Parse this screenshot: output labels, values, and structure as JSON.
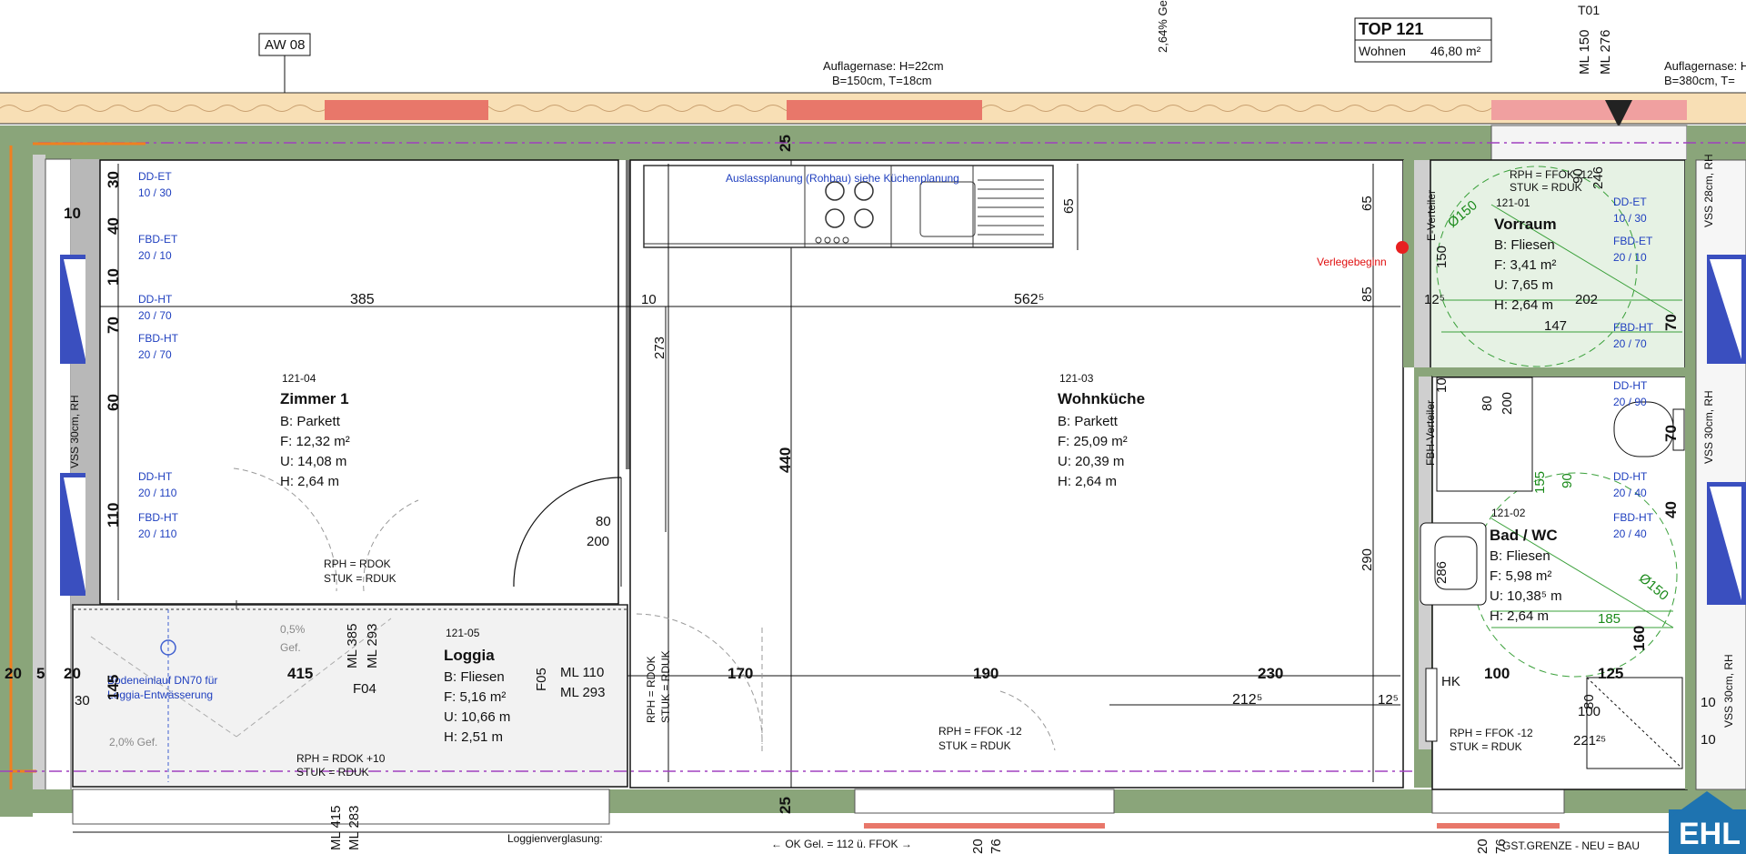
{
  "header": {
    "tag": "AW 08",
    "slope": "2,64% Ge",
    "top_title": "TOP 121",
    "top_type": "Wohnen",
    "top_area": "46,80 m²",
    "t01": "T01",
    "ml_top1": "ML 150",
    "ml_top2": "ML 276",
    "auflager_left_1": "Auflagernase: H=22cm",
    "auflager_left_2": "B=150cm, T=18cm",
    "auflager_right_1": "Auflagernase: H",
    "auflager_right_2": "B=380cm, T="
  },
  "rooms": {
    "zimmer": {
      "id": "121-04",
      "name": "Zimmer 1",
      "b": "B: Parkett",
      "f": "F: 12,32 m²",
      "u": "U: 14,08 m",
      "h": "H: 2,64 m"
    },
    "wohnkueche": {
      "id": "121-03",
      "name": "Wohnküche",
      "b": "B: Parkett",
      "f": "F: 25,09 m²",
      "u": "U: 20,39 m",
      "h": "H: 2,64 m"
    },
    "loggia": {
      "id": "121-05",
      "name": "Loggia",
      "b": "B: Fliesen",
      "f": "F: 5,16 m²",
      "u": "U: 10,66 m",
      "h": "H: 2,51 m"
    },
    "vorraum": {
      "id": "121-01",
      "name": "Vorraum",
      "b": "B: Fliesen",
      "f": "F: 3,41 m²",
      "u": "U: 7,65 m",
      "h": "H: 2,64 m"
    },
    "bad": {
      "id": "121-02",
      "name": "Bad / WC",
      "b": "B: Fliesen",
      "f": "F: 5,98 m²",
      "u": "U: 10,38⁵ m",
      "h": "H: 2,64 m"
    }
  },
  "windows_left": {
    "dd_et": "DD-ET",
    "dd_et_v": "10 / 30",
    "fbd_et": "FBD-ET",
    "fbd_et_v": "20 / 10",
    "dd_ht1": "DD-HT",
    "dd_ht1_v": "20 / 70",
    "fbd_ht1": "FBD-HT",
    "fbd_ht1_v": "20 / 70",
    "dd_ht2": "DD-HT",
    "dd_ht2_v": "20 / 110",
    "fbd_ht2": "FBD-HT",
    "fbd_ht2_v": "20 / 110",
    "vss": "VSS 30cm, RH"
  },
  "windows_right": {
    "dd_et": "DD-ET",
    "dd_et_v": "10 / 30",
    "fbd_et": "FBD-ET",
    "fbd_et_v": "20 / 10",
    "fbd_ht": "FBD-HT",
    "fbd_ht_v": "20 / 70",
    "dd_ht1": "DD-HT",
    "dd_ht1_v": "20 / 90",
    "dd_ht2": "DD-HT",
    "dd_ht2_v": "20 / 40",
    "fbd_ht2": "FBD-HT",
    "fbd_ht2_v": "20 / 40",
    "vss1": "VSS 28cm, RH",
    "vss2": "VSS 30cm, RH",
    "vss3": "VSS 30cm, RH"
  },
  "notes": {
    "kueche": "Auslassplanung (Rohbau) siehe Küchenplanung",
    "verlegebeginn": "Verlegebeginn",
    "e_verteiler": "E-Verteiler",
    "fbh_verteiler": "FBH-Verteiler",
    "rph_zimmer_1": "RPH = RDOK",
    "rph_zimmer_2": "STUK = RDUK",
    "rph_vorraum_1": "RPH = FFOK -12",
    "rph_vorraum_2": "STUK = RDUK",
    "rph_wohn_1": "RPH = FFOK -12",
    "rph_wohn_2": "STUK = RDUK",
    "rph_loggia_1": "RPH = RDOK +10",
    "rph_loggia_2": "STUK = RDUK",
    "rph_bad_1": "RPH = FFOK -12",
    "rph_bad_2": "STUK = RDUK",
    "rph_vert_1": "RPH = RDOK",
    "rph_vert_2": "STUK = RDUK",
    "bodeneinlauf_1": "Bodeneinlauf DN70 für",
    "bodeneinlauf_2": "Loggia-Entwässerung",
    "gef1": "0,5%",
    "gef1b": "Gef.",
    "gef2": "2,0% Gef.",
    "loggienverglasung": "Loggienverglasung:",
    "ok_gel": "← OK Gel. = 112 ü. FFOK →",
    "gst_grenze": "GST.GRENZE - NEU = BAU",
    "f04": "F04",
    "f05": "F05",
    "ml110": "ML 110",
    "ml293": "ML 293",
    "ml385v": "ML 385",
    "ml293v": "ML 293",
    "ml415": "ML 415",
    "ml283": "ML 283",
    "hk": "HK"
  },
  "dims": {
    "d385": "385",
    "d10": "10",
    "d5625": "562⁵",
    "d273": "273",
    "d440": "440",
    "d80": "80",
    "d200": "200",
    "d25a": "25",
    "d25b": "25",
    "d65a": "65",
    "d65b": "65",
    "d85": "85",
    "d150": "150",
    "d125": "12⁵",
    "d290": "290",
    "d415": "415",
    "d170": "170",
    "d190": "190",
    "d230": "230",
    "d2125": "212⁵",
    "d125b": "12⁵",
    "d100": "100",
    "d125c": "125",
    "d20a": "20",
    "d5": "5",
    "d20b": "20",
    "d30": "30",
    "d145": "145",
    "l30": "30",
    "l40": "40",
    "l10": "10",
    "l70": "70",
    "l60": "60",
    "l110": "110",
    "l10b": "10",
    "v246": "246",
    "v90": "90",
    "v202": "202",
    "v147": "147",
    "v70a": "70",
    "b80": "80",
    "b200": "200",
    "b155": "155",
    "b90": "90",
    "b185": "185",
    "b2212": "221²⁵",
    "b100": "100",
    "b80b": "80",
    "b70": "70",
    "b40": "40",
    "b160": "160",
    "b10": "10",
    "b10b": "10",
    "b286": "286",
    "d150c": "Ø150",
    "d150d": "Ø150",
    "b10c": "10",
    "bot20": "20",
    "bot76": "76",
    "bot20b": "20",
    "bot76b": "76"
  },
  "logo": {
    "text": "EHL"
  }
}
